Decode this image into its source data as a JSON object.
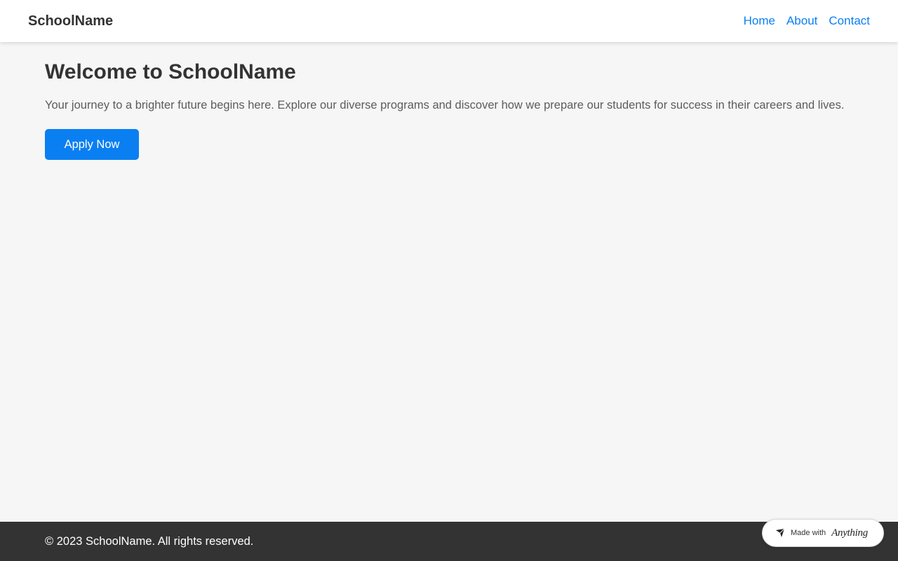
{
  "header": {
    "brand": "SchoolName",
    "nav": [
      {
        "label": "Home"
      },
      {
        "label": "About"
      },
      {
        "label": "Contact"
      }
    ]
  },
  "main": {
    "title": "Welcome to SchoolName",
    "lead": "Your journey to a brighter future begins here. Explore our diverse programs and discover how we prepare our students for success in their careers and lives.",
    "cta_label": "Apply Now"
  },
  "footer": {
    "copyright": "© 2023 SchoolName. All rights reserved."
  },
  "badge": {
    "prefix": "Made with",
    "brand": "Anything",
    "icon": "anything-logo-icon"
  },
  "colors": {
    "accent": "#0a7ff2",
    "background": "#f6f6f6",
    "footer": "#333333"
  }
}
